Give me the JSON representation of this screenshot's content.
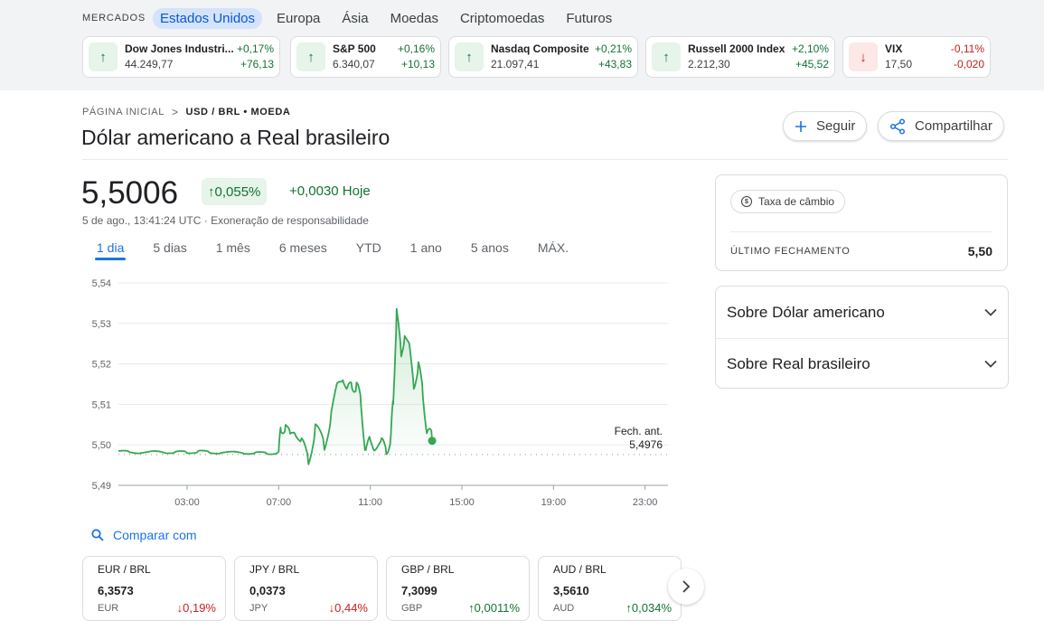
{
  "markets": {
    "label": "MERCADOS",
    "tabs": [
      "Estados Unidos",
      "Europa",
      "Ásia",
      "Moedas",
      "Criptomoedas",
      "Futuros"
    ],
    "active_tab": "Estados Unidos",
    "tickers": [
      {
        "name": "Dow Jones Industri...",
        "value": "44.249,77",
        "pct": "+0,17%",
        "change": "+76,13",
        "direction": "up"
      },
      {
        "name": "S&P 500",
        "value": "6.340,07",
        "pct": "+0,16%",
        "change": "+10,13",
        "direction": "up"
      },
      {
        "name": "Nasdaq Composite",
        "value": "21.097,41",
        "pct": "+0,21%",
        "change": "+43,83",
        "direction": "up"
      },
      {
        "name": "Russell 2000 Index",
        "value": "2.212,30",
        "pct": "+2,10%",
        "change": "+45,52",
        "direction": "up"
      },
      {
        "name": "VIX",
        "value": "17,50",
        "pct": "-0,11%",
        "change": "-0,020",
        "direction": "down"
      }
    ]
  },
  "breadcrumb": {
    "home": "PÁGINA INICIAL",
    "separator": ">",
    "current": "USD / BRL • MOEDA"
  },
  "page_title": "Dólar americano a Real brasileiro",
  "actions": {
    "follow": "Seguir",
    "share": "Compartilhar"
  },
  "quote": {
    "price": "5,5006",
    "pct_change": "0,055%",
    "abs_change": "+0,0030 Hoje",
    "timestamp": "5 de ago., 13:41:24 UTC",
    "disclaimer": "Exoneração de responsabilidade"
  },
  "ranges": [
    "1 dia",
    "5 dias",
    "1 mês",
    "6 meses",
    "YTD",
    "1 ano",
    "5 anos",
    "MÁX."
  ],
  "active_range": "1 dia",
  "chart_data": {
    "type": "line",
    "title": "",
    "xlabel": "",
    "ylabel": "",
    "x_ticks": [
      "03:00",
      "07:00",
      "11:00",
      "15:00",
      "19:00",
      "23:00"
    ],
    "y_ticks": [
      "5,49",
      "5,50",
      "5,51",
      "5,52",
      "5,53",
      "5,54"
    ],
    "ylim": [
      5.49,
      5.54
    ],
    "xlim_hours": [
      0,
      24
    ],
    "grid": true,
    "line_color": "#34a853",
    "previous_close": {
      "label": "Fech. ant.",
      "value": "5,4976",
      "numeric": 5.4976
    },
    "series": [
      {
        "x": [
          0,
          0.5,
          1,
          1.5,
          2,
          2.5,
          3,
          3.5,
          4,
          4.5,
          5,
          5.5,
          6,
          6.5,
          7,
          7.1,
          7.3,
          7.5,
          7.7,
          8,
          8.3,
          8.6,
          9,
          9.3,
          9.6,
          9.8,
          10,
          10.2,
          10.4,
          10.6,
          10.8,
          11,
          11.2,
          11.5,
          11.7,
          11.9,
          12,
          12.15,
          12.35,
          12.5,
          12.7,
          12.9,
          13.1,
          13.3,
          13.5,
          13.7
        ],
        "values": [
          5.4985,
          5.498,
          5.4983,
          5.4981,
          5.4984,
          5.498,
          5.4982,
          5.4985,
          5.4979,
          5.4983,
          5.498,
          5.4982,
          5.4978,
          5.498,
          5.4982,
          5.503,
          5.506,
          5.501,
          5.505,
          5.4995,
          5.497,
          5.504,
          5.499,
          5.509,
          5.514,
          5.518,
          5.512,
          5.516,
          5.514,
          5.51,
          5.499,
          5.5,
          5.5005,
          5.4995,
          5.4998,
          5.501,
          5.511,
          5.5335,
          5.521,
          5.5285,
          5.523,
          5.516,
          5.5185,
          5.513,
          5.503,
          5.501
        ]
      }
    ],
    "current_point": {
      "x": 13.7,
      "value": 5.501
    }
  },
  "compare": {
    "label": "Comparar com"
  },
  "related": [
    {
      "pair": "EUR / BRL",
      "value": "6,3573",
      "currency": "EUR",
      "pct": "0,19%",
      "direction": "down"
    },
    {
      "pair": "JPY / BRL",
      "value": "0,0373",
      "currency": "JPY",
      "pct": "0,44%",
      "direction": "down"
    },
    {
      "pair": "GBP / BRL",
      "value": "7,3099",
      "currency": "GBP",
      "pct": "0,0011%",
      "direction": "up"
    },
    {
      "pair": "AUD / BRL",
      "value": "3,5610",
      "currency": "AUD",
      "pct": "0,034%",
      "direction": "up"
    }
  ],
  "rate_card": {
    "chip": "Taxa de câmbio",
    "label": "ÚLTIMO FECHAMENTO",
    "value": "5,50"
  },
  "about": {
    "usd": "Sobre Dólar americano",
    "brl": "Sobre Real brasileiro"
  },
  "colors": {
    "up": "#137333",
    "down": "#c5221f",
    "accent": "#1a73e8",
    "line": "#34a853"
  }
}
